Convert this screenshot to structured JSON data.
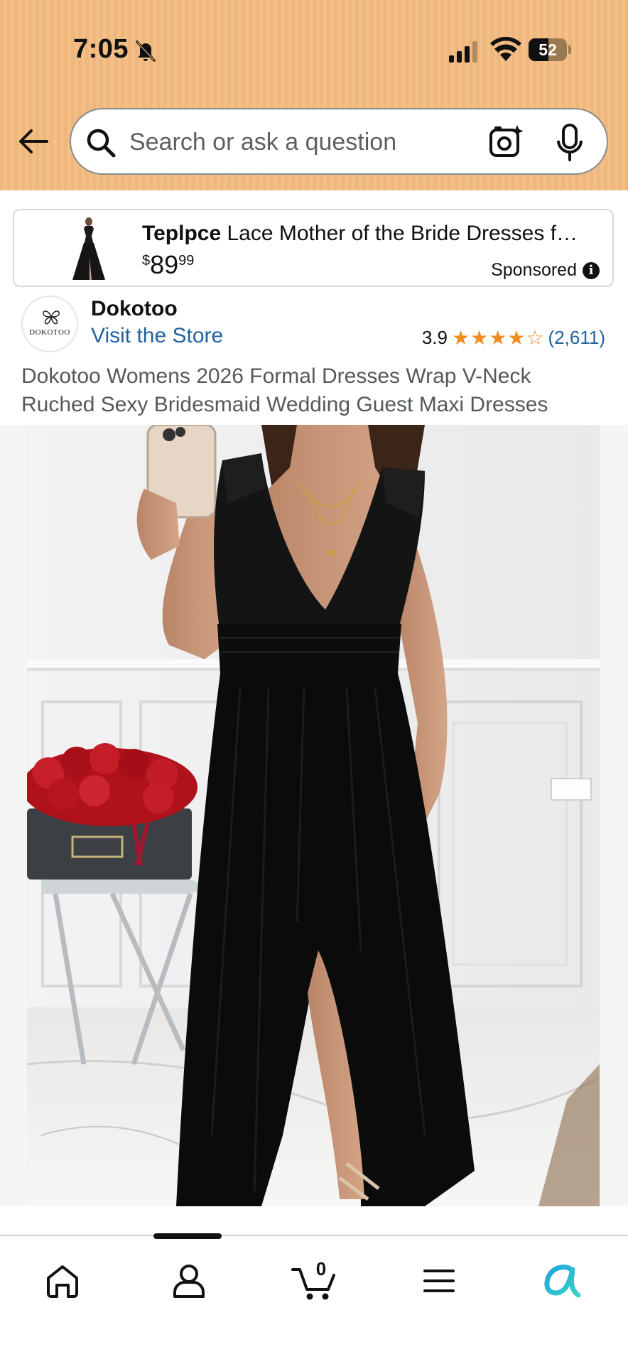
{
  "status_bar": {
    "time": "7:05",
    "battery": "52",
    "battery_level": 0.52
  },
  "search": {
    "placeholder": "Search or ask a question"
  },
  "sponsored_ad": {
    "brand": "Teplpce",
    "title": "Lace Mother of the Bride Dresses f…",
    "price_currency": "$",
    "price_whole": "89",
    "price_fraction": "99",
    "label": "Sponsored"
  },
  "store": {
    "logo_text": "DOKOTOO",
    "name": "Dokotoo",
    "visit_link": "Visit the Store"
  },
  "rating": {
    "value": "3.9",
    "stars_out_of_5": 3.9,
    "count": "(2,611)"
  },
  "product": {
    "title": "Dokotoo Womens 2026 Formal Dresses Wrap V-Neck Ruched Sexy Bridesmaid Wedding Guest Maxi Dresses"
  },
  "bottom_nav": {
    "items": [
      "home-icon",
      "account-icon",
      "cart-icon",
      "menu-icon",
      "rufus-icon"
    ],
    "cart_count": "0"
  },
  "colors": {
    "header": "#f0b97f",
    "link": "#2162a1",
    "star": "#f08c1e"
  }
}
